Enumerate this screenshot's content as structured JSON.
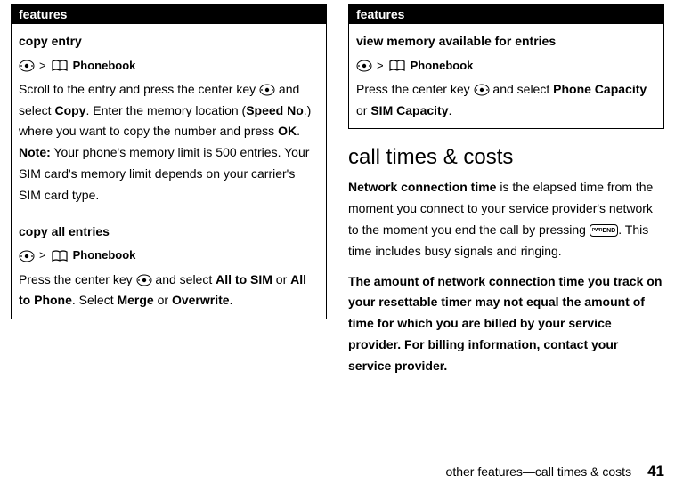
{
  "left": {
    "features_header": "features",
    "copy_entry": {
      "title": "copy entry",
      "phonebook": "Phonebook",
      "body1_pre": "Scroll to the entry and press the center key ",
      "body1_mid1": " and select ",
      "body1_copy": "Copy",
      "body1_mid2": ". Enter the memory location (",
      "body1_speed": "Speed No",
      "body1_mid3": ".) where you want to copy the number and press ",
      "body1_ok": "OK",
      "body1_end": ".",
      "note_label": "Note:",
      "note_text": " Your phone's memory limit is 500 entries. Your SIM card's memory limit depends on your carrier's SIM card type."
    },
    "copy_all": {
      "title": "copy all entries",
      "phonebook": "Phonebook",
      "body_pre": "Press the center key ",
      "body_mid1": " and select ",
      "all_to_sim": "All to SIM",
      "or1": " or ",
      "all_to_phone": "All to Phone",
      "body_mid2": ". Select ",
      "merge": "Merge",
      "or2": " or ",
      "overwrite": "Overwrite",
      "body_end": "."
    }
  },
  "right": {
    "features_header": "features",
    "view_mem": {
      "title": "view memory available for entries",
      "phonebook": "Phonebook",
      "body_pre": "Press the center key ",
      "body_mid1": " and select ",
      "phone_cap": "Phone Capacity",
      "or1": " or ",
      "sim_cap": "SIM Capacity",
      "body_end": "."
    },
    "section_title": "call times & costs",
    "para1_pre": "Network connection time",
    "para1_rest": " is the elapsed time from the moment you connect to your service provider's network to the moment you end the call by pressing ",
    "para1_end": ". This time includes busy signals and ringing.",
    "para2": "The amount of network connection time you track on your resettable timer may not equal the amount of time for which you are billed by your service provider. For billing information, contact your service provider.",
    "end_key_label": "END",
    "footer_text": "other features—call times & costs",
    "page_num": "41"
  },
  "glyphs": {
    "gt": ">"
  }
}
